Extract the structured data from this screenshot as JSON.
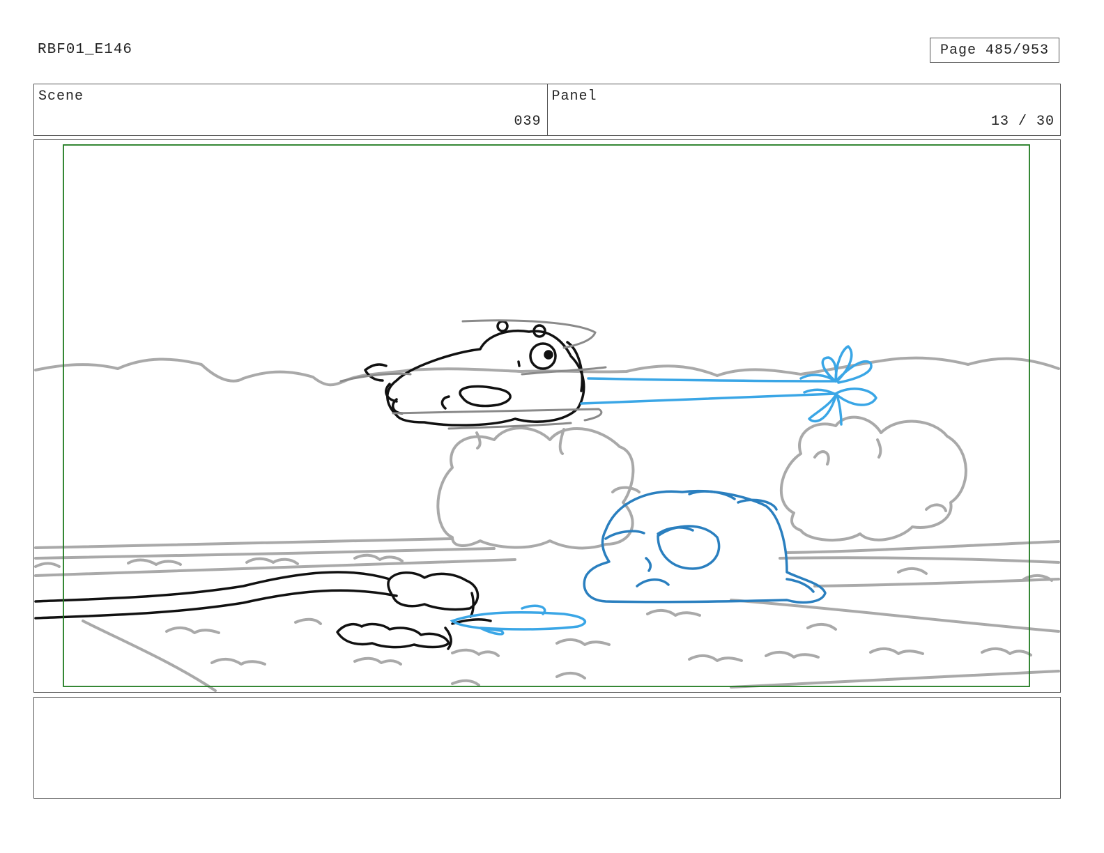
{
  "document": {
    "id": "RBF01_E146",
    "page_label": "Page 485/953"
  },
  "header": {
    "scene_label": "Scene",
    "scene_value": "039",
    "panel_label": "Panel",
    "panel_value": "13 / 30"
  },
  "panel_drawing": {
    "safe_frame_color": "#1f7a1f",
    "background_line_color": "#a9a9a9",
    "character_line_color": "#111111",
    "blue_character_color": "#2a7fbf",
    "water_spray_color": "#3aa6e6"
  },
  "notes": {
    "text": ""
  }
}
